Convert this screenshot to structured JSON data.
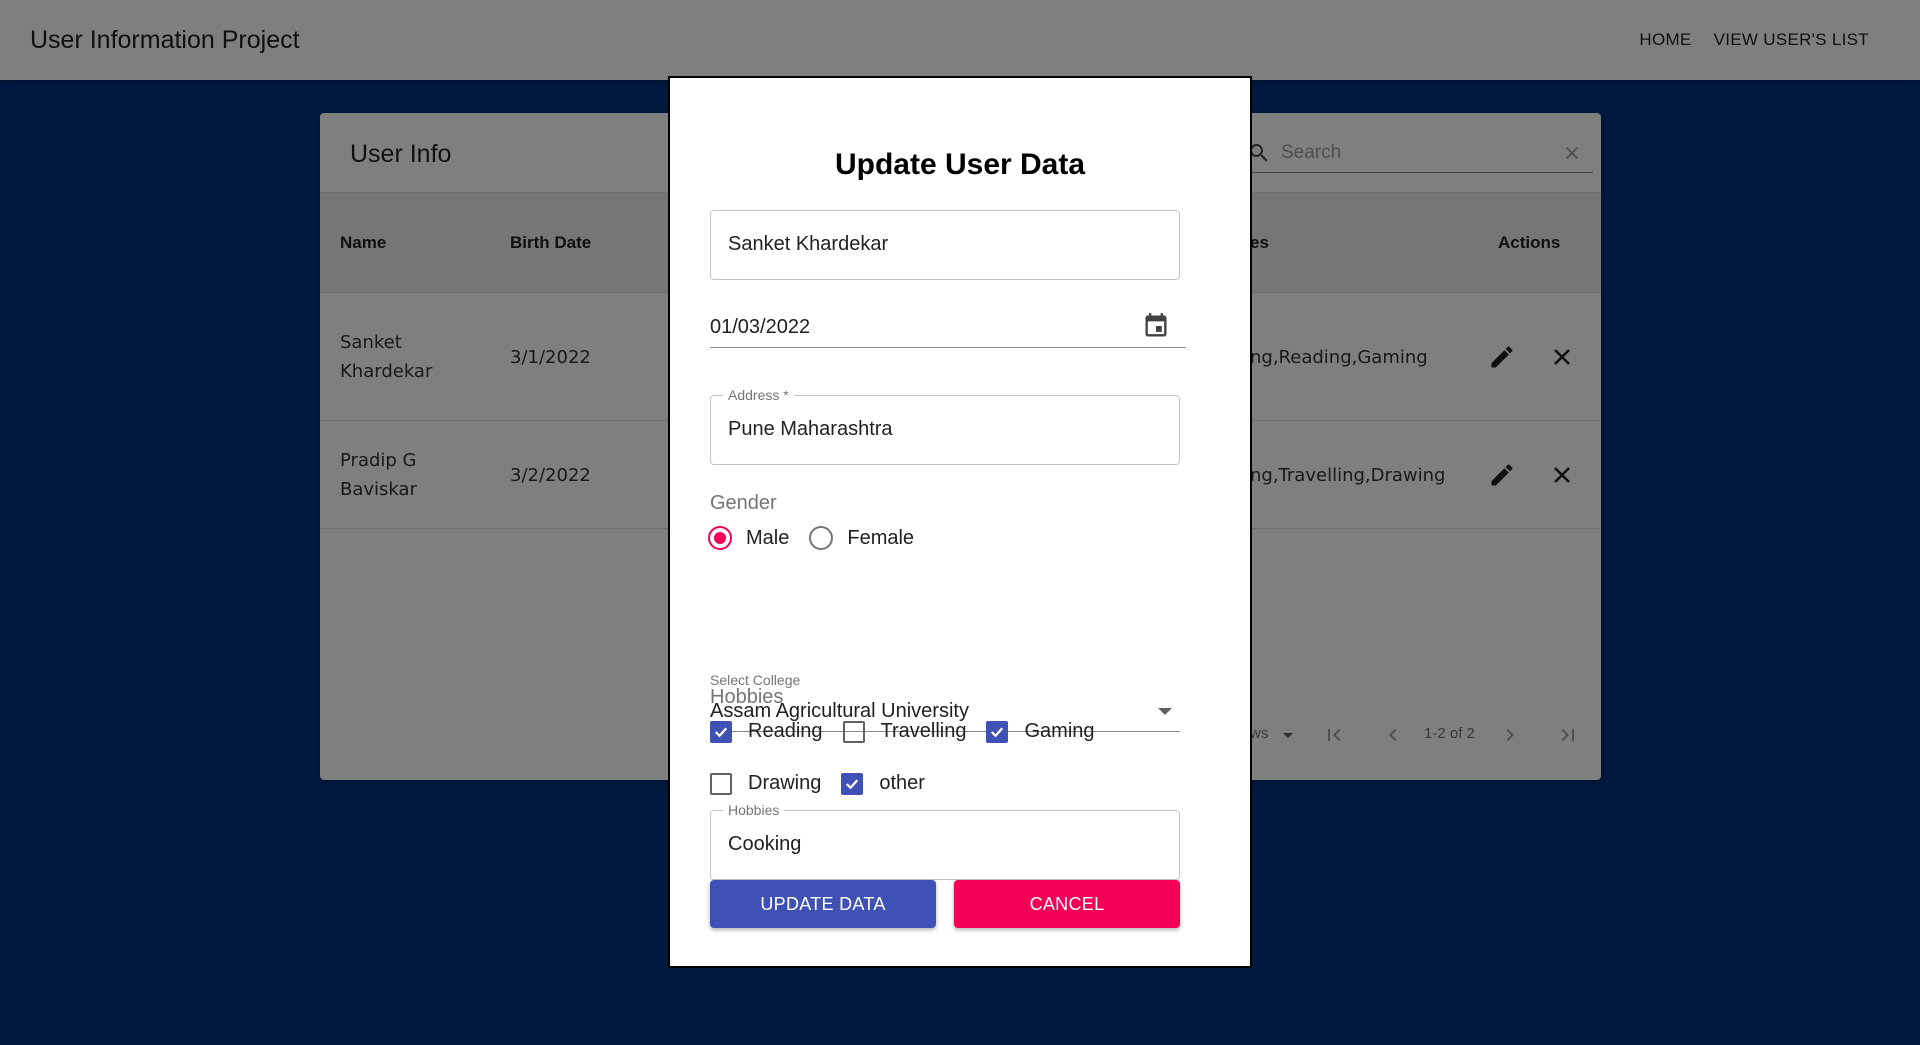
{
  "appbar": {
    "title": "User Information Project",
    "nav": [
      "HOME",
      "VIEW USER'S LIST"
    ]
  },
  "table": {
    "title": "User Info",
    "search_placeholder": "Search",
    "headers": {
      "name": "Name",
      "birth_date": "Birth Date",
      "hobbies": "es",
      "actions": "Actions"
    },
    "rows": [
      {
        "name_line1": "Sanket",
        "name_line2": "Khardekar",
        "birth_date": "3/1/2022",
        "hobbies": "ng,Reading,Gaming"
      },
      {
        "name_line1": "Pradip G",
        "name_line2": "Baviskar",
        "birth_date": "3/2/2022",
        "hobbies": "ng,Travelling,Drawing"
      }
    ],
    "pagination": {
      "rows_label": "ws",
      "range": "1-2 of 2"
    }
  },
  "dialog": {
    "title": "Update User Data",
    "name_value": "Sanket Khardekar",
    "date_value": "01/03/2022",
    "address_label": "Address *",
    "address_value": "Pune Maharashtra",
    "gender_label": "Gender",
    "gender_options": [
      "Male",
      "Female"
    ],
    "gender_selected": "Male",
    "college_label": "Select College",
    "college_value": "Assam Agricultural University",
    "hobbies_label": "Hobbies",
    "hobby_options": [
      {
        "label": "Reading",
        "checked": true
      },
      {
        "label": "Travelling",
        "checked": false
      },
      {
        "label": "Gaming",
        "checked": true
      },
      {
        "label": "Drawing",
        "checked": false
      },
      {
        "label": "other",
        "checked": true
      }
    ],
    "other_hobby_label": "Hobbies",
    "other_hobby_value": "Cooking",
    "update_button": "UPDATE DATA",
    "cancel_button": "CANCEL"
  },
  "colors": {
    "background": "#02327e",
    "primary": "#3f51b5",
    "secondary": "#f50057"
  },
  "icons": [
    "search-icon",
    "clear-icon",
    "edit-icon",
    "close-icon",
    "calendar-icon",
    "dropdown-caret-icon",
    "first-page-icon",
    "prev-page-icon",
    "next-page-icon",
    "last-page-icon"
  ]
}
